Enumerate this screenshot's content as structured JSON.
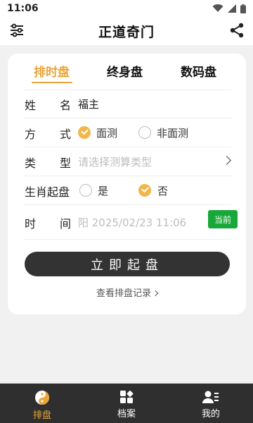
{
  "status_bar": {
    "time": "11:06"
  },
  "app_bar": {
    "title": "正道奇门"
  },
  "tabs": [
    {
      "label": "排时盘",
      "active": true
    },
    {
      "label": "终身盘",
      "active": false
    },
    {
      "label": "数码盘",
      "active": false
    }
  ],
  "form": {
    "name": {
      "label_a": "姓",
      "label_b": "名",
      "value": "福主"
    },
    "method": {
      "label_a": "方",
      "label_b": "式",
      "options": [
        {
          "label": "面测",
          "checked": true
        },
        {
          "label": "非面测",
          "checked": false
        }
      ]
    },
    "type": {
      "label_a": "类",
      "label_b": "型",
      "placeholder": "请选择测算类型"
    },
    "zodiac": {
      "label": "生肖起盘",
      "options": [
        {
          "label": "是",
          "checked": false
        },
        {
          "label": "否",
          "checked": true
        }
      ]
    },
    "time": {
      "label_a": "时",
      "label_b": "间",
      "value": "阳 2025/02/23 11:06",
      "now_button": "当前"
    }
  },
  "start_button": "立即起盘",
  "history_link": "查看排盘记录",
  "bottom_nav": [
    {
      "label": "排盘",
      "icon": "yin-yang-icon",
      "active": true
    },
    {
      "label": "档案",
      "icon": "archive-icon",
      "active": false
    },
    {
      "label": "我的",
      "icon": "profile-icon",
      "active": false
    }
  ],
  "colors": {
    "accent": "#e9a53a",
    "now_button": "#18a83a",
    "dark": "#333333"
  }
}
